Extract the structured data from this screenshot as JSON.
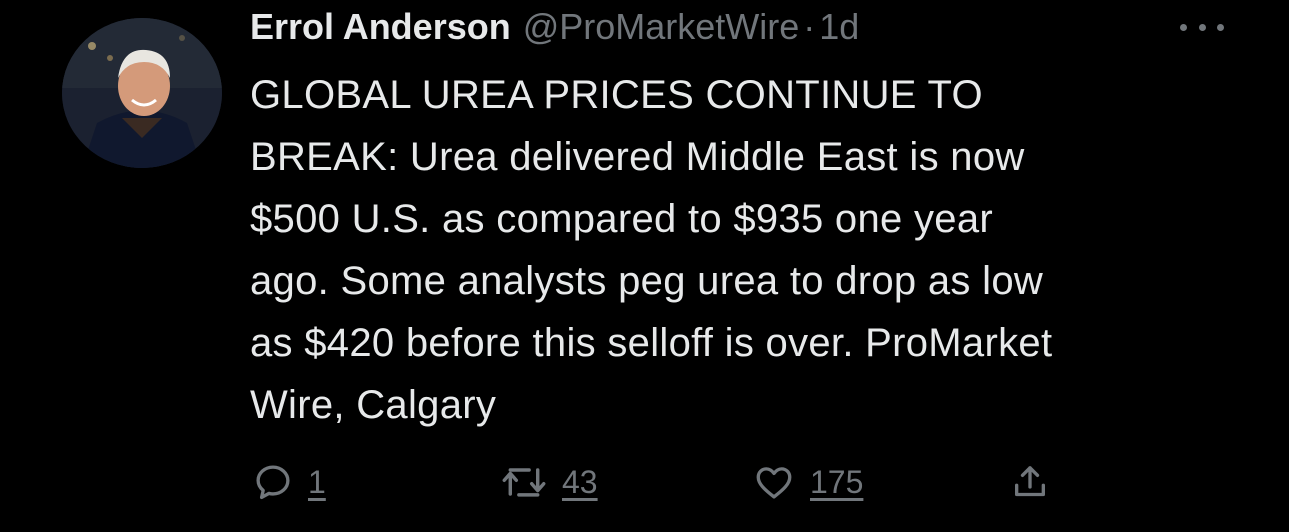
{
  "tweet": {
    "author_name": "Errol Anderson",
    "handle": "@ProMarketWire",
    "separator": "·",
    "time": "1d",
    "lines": [
      "GLOBAL UREA PRICES CONTINUE TO",
      "BREAK: Urea delivered Middle East is now",
      "$500 U.S. as compared to $935 one year",
      "ago. Some analysts peg urea to drop as low",
      "as $420 before this selloff is over. ProMarket",
      "Wire, Calgary"
    ],
    "actions": {
      "replies": "1",
      "retweets": "43",
      "likes": "175"
    }
  },
  "icons": {
    "more": "more-horizontal-icon",
    "reply": "reply-icon",
    "retweet": "retweet-icon",
    "like": "heart-icon",
    "share": "share-icon"
  },
  "colors": {
    "background": "#000000",
    "text": "#e7e9ea",
    "muted": "#71767b"
  }
}
